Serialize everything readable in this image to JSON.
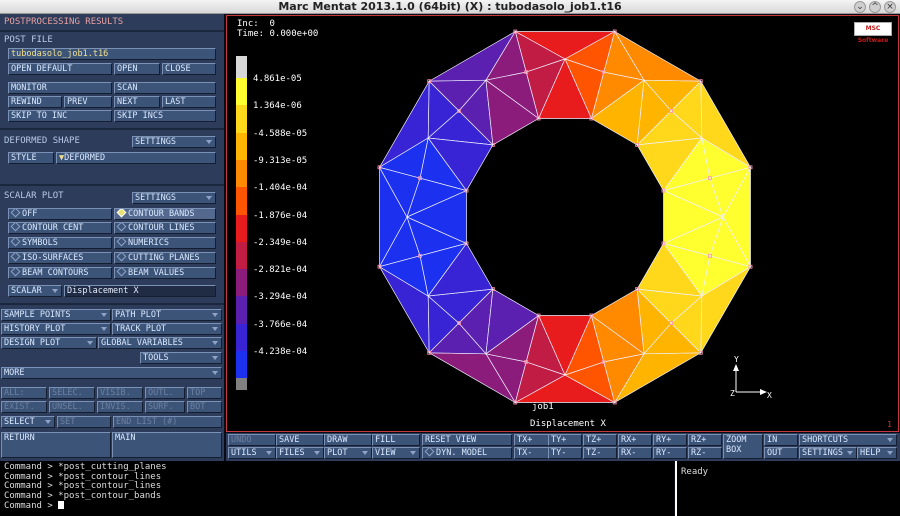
{
  "window": {
    "title": "Marc Mentat 2013.1.0 (64bit) (X) : tubodasolo_job1.t16",
    "controls": [
      "⌄",
      "^",
      "×"
    ]
  },
  "panel": {
    "title": "POSTPROCESSING RESULTS",
    "post_file_header": "POST FILE",
    "post_file_value": "tubodasolo_job1.t16",
    "open_default": "OPEN DEFAULT",
    "open": "OPEN",
    "close": "CLOSE",
    "monitor": "MONITOR",
    "scan": "SCAN",
    "rewind": "REWIND",
    "prev": "PREV",
    "next": "NEXT",
    "last": "LAST",
    "skip_to_inc": "SKIP TO INC",
    "skip_incs": "SKIP INCS",
    "deformed_shape_header": "DEFORMED SHAPE",
    "settings": "SETTINGS",
    "style": "STYLE",
    "style_value": "DEFORMED",
    "scalar_plot_header": "SCALAR PLOT",
    "off": "OFF",
    "contour_bands": "CONTOUR BANDS",
    "contour_cent": "CONTOUR CENT",
    "contour_lines": "CONTOUR LINES",
    "symbols": "SYMBOLS",
    "numerics": "NUMERICS",
    "iso_surfaces": "ISO-SURFACES",
    "cutting_planes": "CUTTING PLANES",
    "beam_contours": "BEAM CONTOURS",
    "beam_values": "BEAM VALUES",
    "scalar": "SCALAR",
    "scalar_value": "Displacement X",
    "sample_points": "SAMPLE POINTS",
    "path_plot": "PATH PLOT",
    "history_plot": "HISTORY PLOT",
    "track_plot": "TRACK PLOT",
    "design_plot": "DESIGN PLOT",
    "global_variables": "GLOBAL VARIABLES",
    "tools": "TOOLS",
    "more": "MORE",
    "all": "ALL:",
    "selec": "SELEC.",
    "visib": "VISIB.",
    "outl": "OUTL.",
    "top": "TOP",
    "exist": "EXIST.",
    "unsel": "UNSEL.",
    "invis": "INVIS.",
    "surf": "SURF.",
    "bot": "BOT",
    "select": "SELECT",
    "set": "SET",
    "end_list": "END LIST (#)",
    "return": "RETURN",
    "main": "MAIN"
  },
  "viewport": {
    "inc_label": "Inc:",
    "inc_value": "0",
    "time_label": "Time:",
    "time_value": "0.000e+00",
    "logo": "MSC Software",
    "legend_values": [
      "4.861e-05",
      "1.364e-06",
      "-4.588e-05",
      "-9.313e-05",
      "-1.404e-04",
      "-1.876e-04",
      "-2.349e-04",
      "-2.821e-04",
      "-3.294e-04",
      "-3.766e-04",
      "-4.238e-04"
    ],
    "legend_colors": [
      "#ffff30",
      "#ffd81c",
      "#ffb400",
      "#ff8a00",
      "#ff5400",
      "#e81c1c",
      "#c01c44",
      "#8c1c7c",
      "#5c20b0",
      "#3824d4",
      "#1c30f0"
    ],
    "job_label": "job1",
    "quantity_label": "Displacement X",
    "page_number": "1",
    "axis_y": "Y",
    "axis_z": "Z",
    "axis_x": "X"
  },
  "toolbar": {
    "undo": "UNDO",
    "save": "SAVE",
    "draw": "DRAW",
    "fill": "FILL",
    "reset_view": "RESET VIEW",
    "tx_plus": "TX+",
    "ty_plus": "TY+",
    "tz_plus": "TZ+",
    "rx_plus": "RX+",
    "ry_plus": "RY+",
    "rz_plus": "RZ+",
    "zoom_box": "ZOOM BOX",
    "in": "IN",
    "shortcuts": "SHORTCUTS",
    "utils": "UTILS",
    "files": "FILES",
    "plot": "PLOT",
    "view": "VIEW",
    "dyn_model": "DYN. MODEL",
    "tx_minus": "TX-",
    "ty_minus": "TY-",
    "tz_minus": "TZ-",
    "rx_minus": "RX-",
    "ry_minus": "RY-",
    "rz_minus": "RZ-",
    "out": "OUT",
    "settings": "SETTINGS",
    "help": "HELP"
  },
  "console": {
    "lines": [
      "Command > *post_cutting_planes",
      "Command > *post_contour_lines",
      "Command > *post_contour_lines",
      "Command > *post_contour_bands"
    ],
    "prompt": "Command > "
  },
  "status": {
    "text": "Ready"
  }
}
